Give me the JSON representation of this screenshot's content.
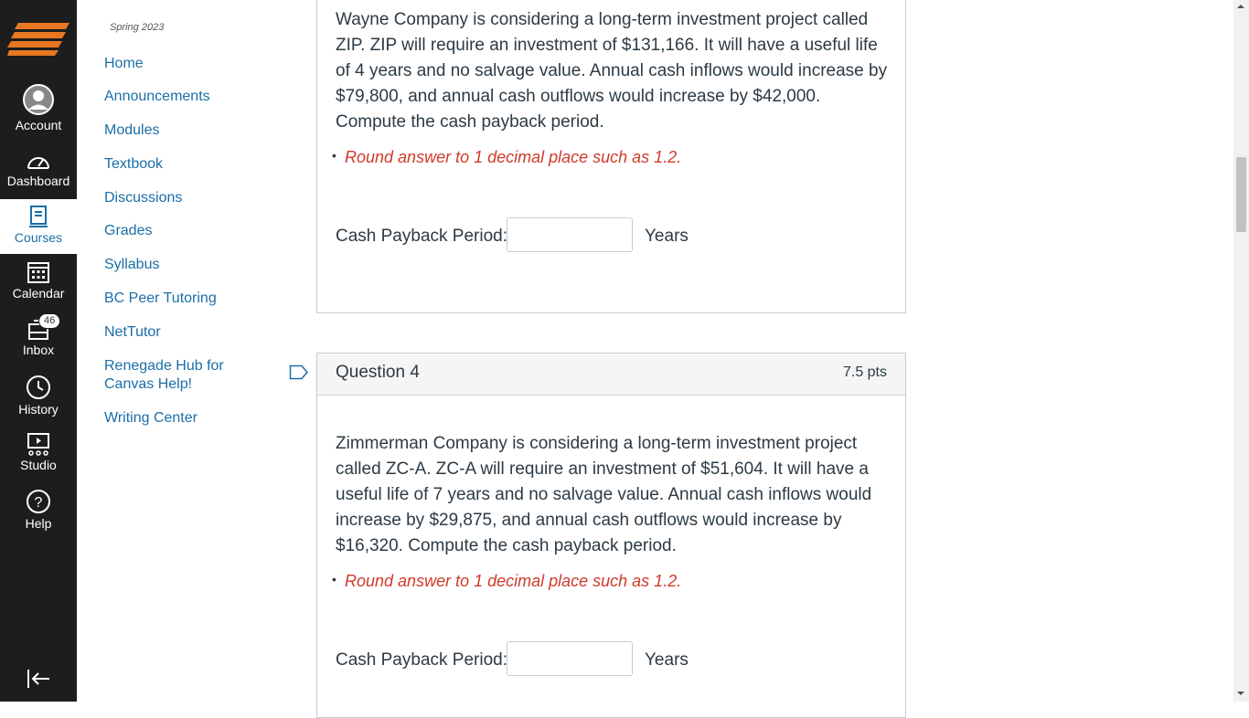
{
  "global_nav": {
    "items": [
      {
        "label": "Account",
        "icon": "account-icon"
      },
      {
        "label": "Dashboard",
        "icon": "dashboard-icon"
      },
      {
        "label": "Courses",
        "icon": "courses-icon"
      },
      {
        "label": "Calendar",
        "icon": "calendar-icon"
      },
      {
        "label": "Inbox",
        "icon": "inbox-icon",
        "badge": "46"
      },
      {
        "label": "History",
        "icon": "history-icon"
      },
      {
        "label": "Studio",
        "icon": "studio-icon"
      },
      {
        "label": "Help",
        "icon": "help-icon"
      }
    ],
    "active": "Courses"
  },
  "course_nav": {
    "term": "Spring 2023",
    "links": [
      "Home",
      "Announcements",
      "Modules",
      "Textbook",
      "Discussions",
      "Grades",
      "Syllabus",
      "BC Peer Tutoring",
      "NetTutor",
      "Renegade Hub for Canvas Help!",
      "Writing Center"
    ]
  },
  "question3": {
    "text": "Wayne Company is considering a long-term investment project called ZIP. ZIP will require an investment of $131,166. It will have a useful life of 4 years and no salvage value. Annual cash inflows would increase by $79,800, and annual cash outflows would increase by $42,000. Compute the cash payback period.",
    "hint": "Round answer to 1 decimal place such as 1.2.",
    "answer_label": "Cash Payback Period:",
    "answer_value": "",
    "unit": "Years"
  },
  "question4": {
    "title": "Question 4",
    "points": "7.5 pts",
    "text": "Zimmerman Company is considering a long-term investment project called ZC-A. ZC-A will require an investment of $51,604. It will have a useful life of 7 years and no salvage value. Annual cash inflows would increase by $29,875, and annual cash outflows would increase by $16,320. Compute the cash payback period.",
    "hint": "Round answer to 1 decimal place such as 1.2.",
    "answer_label": "Cash Payback Period:",
    "answer_value": "",
    "unit": "Years"
  },
  "colors": {
    "nav_bg": "#1d1d1d",
    "link": "#1b6ea8",
    "hint": "#d03a2a",
    "logo": "#e87722"
  }
}
